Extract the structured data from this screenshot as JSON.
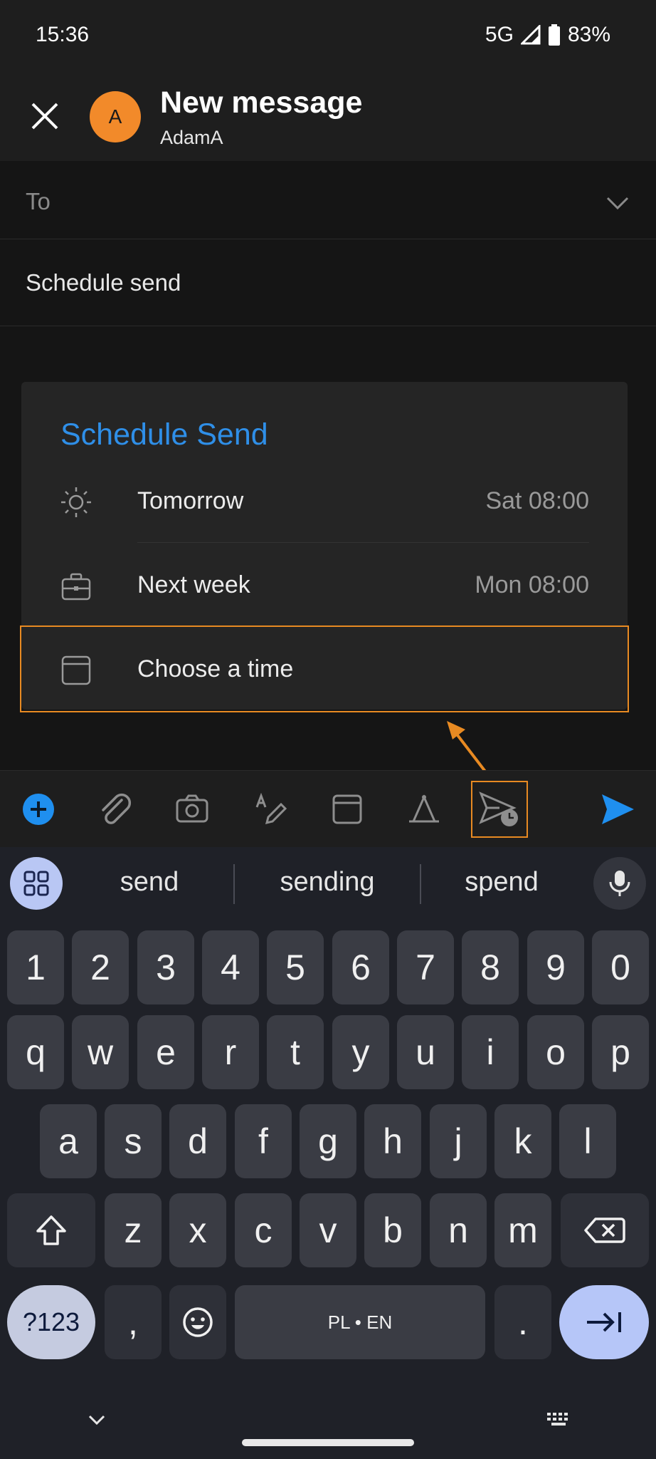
{
  "status": {
    "time": "15:36",
    "network": "5G",
    "battery": "83%"
  },
  "header": {
    "title": "New message",
    "account": "AdamA",
    "avatar_letter": "A"
  },
  "compose": {
    "to_label": "To",
    "subject": "Schedule send"
  },
  "schedule": {
    "title": "Schedule Send",
    "options": [
      {
        "label": "Tomorrow",
        "time": "Sat 08:00",
        "icon": "sun-icon"
      },
      {
        "label": "Next week",
        "time": "Mon 08:00",
        "icon": "briefcase-icon"
      },
      {
        "label": "Choose a time",
        "time": "",
        "icon": "calendar-icon"
      }
    ]
  },
  "toolbar": {
    "items": [
      "add-icon",
      "attach-icon",
      "camera-icon",
      "draw-icon",
      "calendar-icon",
      "format-icon",
      "schedule-send-icon",
      "send-icon"
    ]
  },
  "keyboard": {
    "suggestions": [
      "send",
      "sending",
      "spend"
    ],
    "row1": [
      "1",
      "2",
      "3",
      "4",
      "5",
      "6",
      "7",
      "8",
      "9",
      "0"
    ],
    "row2": [
      "q",
      "w",
      "e",
      "r",
      "t",
      "y",
      "u",
      "i",
      "o",
      "p"
    ],
    "row3": [
      "a",
      "s",
      "d",
      "f",
      "g",
      "h",
      "j",
      "k",
      "l"
    ],
    "row4": [
      "z",
      "x",
      "c",
      "v",
      "b",
      "n",
      "m"
    ],
    "symbols_label": "?123",
    "comma": ",",
    "space_label": "PL • EN",
    "period": "."
  },
  "colors": {
    "accent": "#2f8fe8",
    "avatar": "#f28a2a",
    "highlight": "#e88a22"
  }
}
